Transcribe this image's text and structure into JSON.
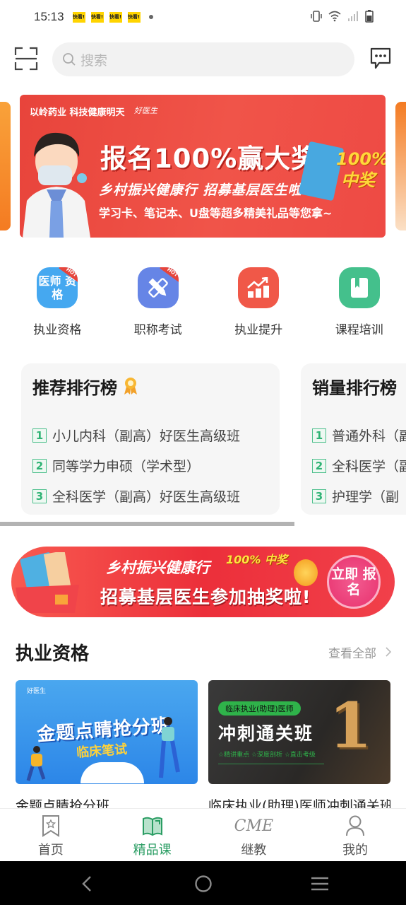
{
  "status_bar": {
    "time": "15:13",
    "notifications": [
      "快看!",
      "快看!",
      "快看!",
      "快看!"
    ]
  },
  "header": {
    "search_placeholder": "搜索",
    "scan_icon": "scan-icon",
    "message_icon": "message-icon"
  },
  "banner": {
    "brand": "以岭药业 科技健康明天",
    "brand2": "好医生",
    "title": "报名100%赢大奖!",
    "subtitle": "乡村振兴健康行 招募基层医生啦",
    "subtitle2": "学习卡、笔记本、U盘等超多精美礼品等您拿~",
    "badge": "100% 中奖"
  },
  "categories": [
    {
      "label": "执业资格",
      "icon_text": "医师 资格",
      "hot": "HOT",
      "color": "#45a8f0"
    },
    {
      "label": "职称考试",
      "icon_text": "",
      "hot": "HOT",
      "color": "#6685e6"
    },
    {
      "label": "执业提升",
      "icon_text": "",
      "hot": "",
      "color": "#f05848"
    },
    {
      "label": "课程培训",
      "icon_text": "",
      "hot": "",
      "color": "#44c08c"
    }
  ],
  "rankings": [
    {
      "title": "推荐排行榜",
      "items": [
        {
          "num": "1",
          "text": "小儿内科（副高）好医生高级班"
        },
        {
          "num": "2",
          "text": "同等学力申硕（学术型）"
        },
        {
          "num": "3",
          "text": "全科医学（副高）好医生高级班"
        }
      ]
    },
    {
      "title": "销量排行榜",
      "items": [
        {
          "num": "1",
          "text": "普通外科（副"
        },
        {
          "num": "2",
          "text": "全科医学（副"
        },
        {
          "num": "3",
          "text": "护理学（副"
        }
      ]
    }
  ],
  "banner2": {
    "line1": "乡村振兴健康行",
    "badge": "100% 中奖",
    "line2": "招募基层医生参加抽奖啦!",
    "cta": "立即 报名"
  },
  "section": {
    "title": "执业资格",
    "see_all": "查看全部"
  },
  "courses": [
    {
      "name": "金题点睛抢分班",
      "thumb_logo": "好医生",
      "thumb_title": "金题点睛抢分班",
      "thumb_sub": "临床笔试"
    },
    {
      "name": "临床执业(助理)医师冲刺通关班",
      "thumb_tag": "临床执业(助理)医师",
      "thumb_title": "冲刺通关班",
      "thumb_features": "☆精讲重点  ☆深度剖析  ☆直击考级",
      "thumb_rank": "1"
    }
  ],
  "tabbar": {
    "tabs": [
      {
        "label": "首页",
        "icon": "home-bookmark-icon",
        "active": false
      },
      {
        "label": "精品课",
        "icon": "book-icon",
        "active": true
      },
      {
        "label": "继教",
        "icon_text": "CME",
        "active": false
      },
      {
        "label": "我的",
        "icon": "user-icon",
        "active": false
      }
    ],
    "active_color": "#2a9d63"
  }
}
